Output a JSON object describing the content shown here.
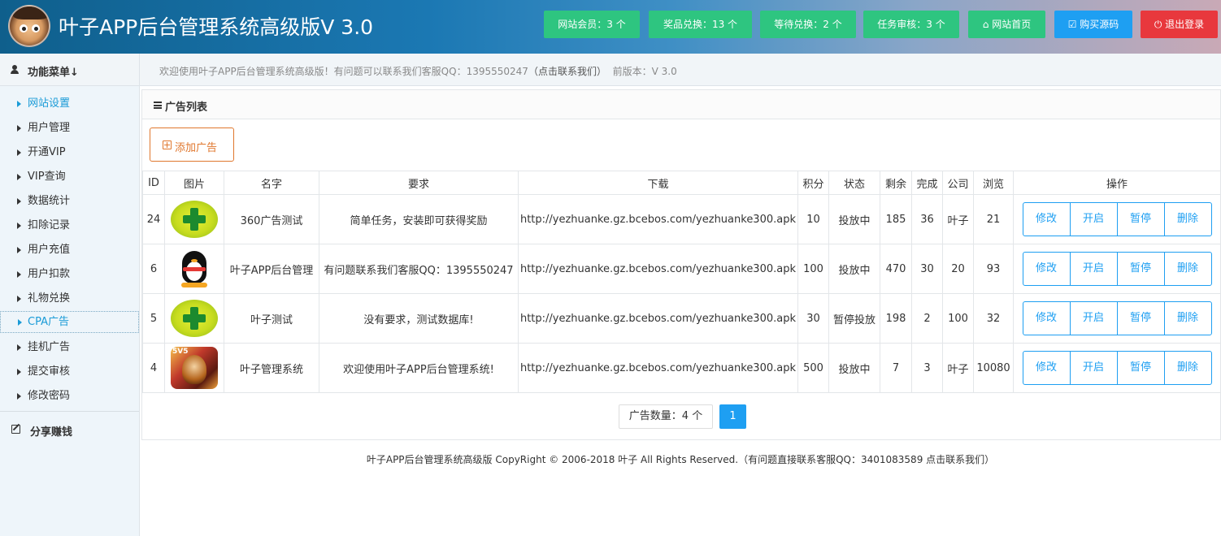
{
  "header": {
    "title": "叶子APP后台管理系统高级版V 3.0",
    "stats": [
      {
        "label": "网站会员：3 个"
      },
      {
        "label": "奖品兑换：13 个"
      },
      {
        "label": "等待兑换：2 个"
      },
      {
        "label": "任务审核：3 个"
      }
    ],
    "home_label": "网站首页",
    "buy_label": "购买源码",
    "logout_label": "退出登录",
    "colors": {
      "green": "#2ec580",
      "blue": "#1e9ff2",
      "red": "#e8383d"
    }
  },
  "menu_head": {
    "title": "功能菜单↓"
  },
  "notice": {
    "text": "欢迎使用叶子APP后台管理系统高级版！有问题可以联系我们客服QQ：1395550247",
    "contact": "（点击联系我们）",
    "version": "前版本：V 3.0"
  },
  "sidebar": {
    "items": [
      {
        "label": "网站设置"
      },
      {
        "label": "用户管理"
      },
      {
        "label": "开通VIP"
      },
      {
        "label": "VIP查询"
      },
      {
        "label": "数据统计"
      },
      {
        "label": "扣除记录"
      },
      {
        "label": "用户充值"
      },
      {
        "label": "用户扣款"
      },
      {
        "label": "礼物兑换"
      },
      {
        "label": "CPA广告"
      },
      {
        "label": "挂机广告"
      },
      {
        "label": "提交审核"
      },
      {
        "label": "修改密码"
      }
    ],
    "share_label": "分享赚钱"
  },
  "panel": {
    "title": "广告列表",
    "add_label": "添加广告"
  },
  "table": {
    "headers": [
      "ID",
      "图片",
      "名字",
      "要求",
      "下载",
      "积分",
      "状态",
      "剩余",
      "完成",
      "公司",
      "浏览",
      "操作"
    ],
    "rows": [
      {
        "id": "24",
        "image": "360-icon",
        "name": "360广告测试",
        "req": "简单任务，安装即可获得奖励",
        "download": "http://yezhuanke.gz.bcebos.com/yezhuanke300.apk",
        "points": "10",
        "status": "投放中",
        "status_color": "#5cb85c",
        "remain": "185",
        "done": "36",
        "company": "叶子",
        "views": "21"
      },
      {
        "id": "6",
        "image": "qq-penguin-icon",
        "name": "叶子APP后台管理",
        "req": "有问题联系我们客服QQ：1395550247",
        "download": "http://yezhuanke.gz.bcebos.com/yezhuanke300.apk",
        "points": "100",
        "status": "投放中",
        "status_color": "#5cb85c",
        "remain": "470",
        "done": "30",
        "company": "20",
        "views": "93"
      },
      {
        "id": "5",
        "image": "360-icon",
        "name": "叶子测试",
        "req": "没有要求，测试数据库!",
        "download": "http://yezhuanke.gz.bcebos.com/yezhuanke300.apk",
        "points": "30",
        "status": "暂停投放",
        "status_color": "#e53935",
        "remain": "198",
        "done": "2",
        "company": "100",
        "views": "32"
      },
      {
        "id": "4",
        "image": "game-5v5-icon",
        "name": "叶子管理系统",
        "req": "欢迎使用叶子APP后台管理系统!",
        "download": "http://yezhuanke.gz.bcebos.com/yezhuanke300.apk",
        "points": "500",
        "status": "投放中",
        "status_color": "#5cb85c",
        "remain": "7",
        "done": "3",
        "company": "叶子",
        "views": "10080"
      }
    ],
    "ops": {
      "edit": "修改",
      "start": "开启",
      "pause": "暂停",
      "delete": "删除"
    }
  },
  "pager": {
    "count": "广告数量：4 个",
    "page": "1"
  },
  "footer": {
    "text": "叶子APP后台管理系统高级版 CopyRight © 2006-2018 叶子 All Rights Reserved.（有问题直接联系客服QQ：3401083589 点击联系我们）"
  }
}
